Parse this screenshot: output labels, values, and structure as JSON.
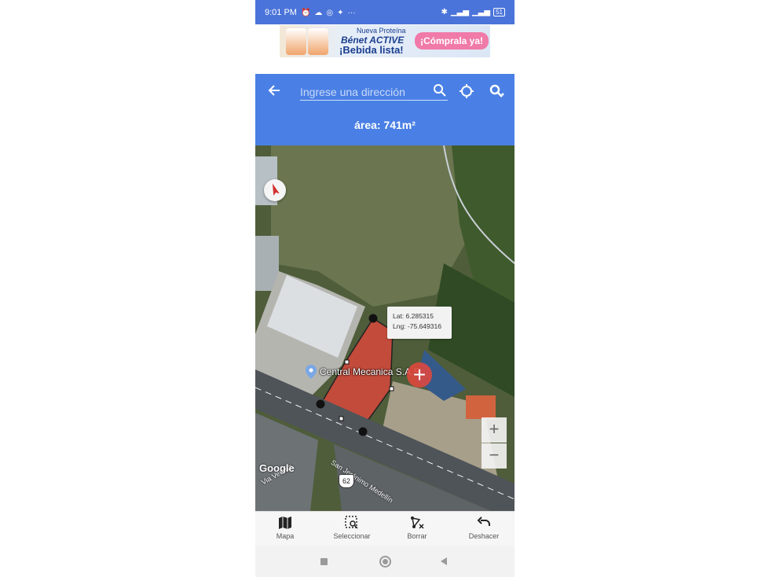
{
  "status_bar": {
    "time": "9:01 PM",
    "left_icons": [
      "alarm-icon",
      "cloud-icon",
      "instagram-icon",
      "twitter-icon",
      "more-icon"
    ],
    "right_icons": [
      "bluetooth-icon",
      "signal-icon",
      "signal-icon",
      "battery-icon"
    ],
    "battery": "51"
  },
  "ad": {
    "line1": "Nueva Proteína",
    "line2": "Bénet ACTIVE",
    "line3": "¡Bebida lista!",
    "cta": "¡Cómprala ya!"
  },
  "app_bar": {
    "search_placeholder": "Ingrese una dirección",
    "area_label": "área: 741m²",
    "color": "#4a80e5"
  },
  "map": {
    "tooltip_lat": "Lat: 6.285315",
    "tooltip_lng": "Lng: -75.649316",
    "place_name": "Central Mecanica S.A.S.",
    "google": "Google",
    "road_name": "San Jerónimo Medellín",
    "road_name_2": "Via Vereda",
    "route_number": "62",
    "zoom_in": "+",
    "zoom_out": "−",
    "polygon_color": "#e8463c"
  },
  "bottom_nav": [
    {
      "label": "Mapa",
      "icon": "map-icon"
    },
    {
      "label": "Seleccionar",
      "icon": "select-area-icon"
    },
    {
      "label": "Borrar",
      "icon": "delete-polygon-icon"
    },
    {
      "label": "Deshacer",
      "icon": "undo-icon"
    }
  ]
}
